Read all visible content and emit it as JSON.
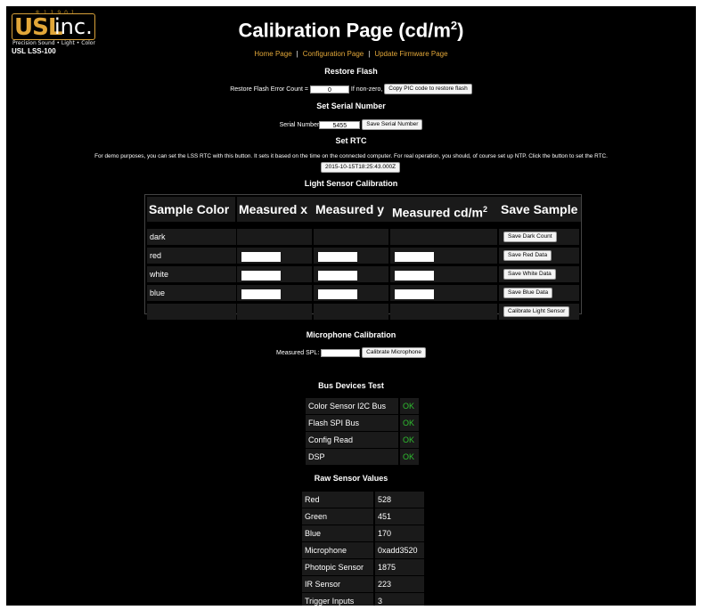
{
  "logo": {
    "reg_text": "® 1 1 9 0 1",
    "usl": "USL",
    "inc": "inc.",
    "tagline": "Precision Sound • Light • Color"
  },
  "model": "USL LSS-100",
  "title": {
    "main": "Calibration Page (cd/m",
    "sup": "2",
    "close": ")"
  },
  "nav": {
    "home": "Home Page",
    "config": "Configuration Page",
    "firmware": "Update Firmware Page",
    "sep": "|"
  },
  "restore_flash": {
    "heading": "Restore Flash",
    "error_label": "Restore Flash Error Count =",
    "error_value": "0",
    "nonzero_label": "If non-zero,",
    "button": "Copy PIC code to restore flash"
  },
  "serial": {
    "heading": "Set Serial Number",
    "label": "Serial Number",
    "value": "5455",
    "button": "Save Serial Number"
  },
  "rtc": {
    "heading": "Set RTC",
    "description": "For demo purposes, you can set the LSS RTC with this button. It sets it based on the time on the connected computer. For real operation, you should, of course set up NTP. Click the button to set the RTC.",
    "button": "2015-10-15T18:25:43.000Z"
  },
  "light_calibration": {
    "heading": "Light Sensor Calibration",
    "headers": {
      "sample_color": "Sample Color",
      "measured_x": "Measured x",
      "measured_y": "Measured y",
      "measured_cd": "Measured cd/m",
      "measured_cd_sup": "2",
      "save_sample": "Save Sample"
    },
    "rows": [
      {
        "label": "dark",
        "button": "Save Dark Count"
      },
      {
        "label": "red",
        "button": "Save Red Data"
      },
      {
        "label": "white",
        "button": "Save White Data"
      },
      {
        "label": "blue",
        "button": "Save Blue Data"
      },
      {
        "label": "",
        "button": "Calibrate Light Sensor"
      }
    ]
  },
  "microphone": {
    "heading": "Microphone Calibration",
    "label": "Measured SPL:",
    "button": "Calibrate Microphone"
  },
  "bus_test": {
    "heading": "Bus Devices Test",
    "rows": [
      {
        "name": "Color Sensor I2C Bus",
        "status": "OK"
      },
      {
        "name": "Flash SPI Bus",
        "status": "OK"
      },
      {
        "name": "Config Read",
        "status": "OK"
      },
      {
        "name": "DSP",
        "status": "OK"
      }
    ]
  },
  "raw_sensor": {
    "heading": "Raw Sensor Values",
    "rows": [
      {
        "name": "Red",
        "value": "528"
      },
      {
        "name": "Green",
        "value": "451"
      },
      {
        "name": "Blue",
        "value": "170"
      },
      {
        "name": "Microphone",
        "value": "0xadd3520"
      },
      {
        "name": "Photopic Sensor",
        "value": "1875"
      },
      {
        "name": "IR Sensor",
        "value": "223"
      },
      {
        "name": "Trigger Inputs",
        "value": "3"
      }
    ]
  },
  "colors": {
    "background": "#000000",
    "accent": "#e2a739",
    "ok": "#2fbf2f",
    "cell": "#1a1a1a"
  }
}
